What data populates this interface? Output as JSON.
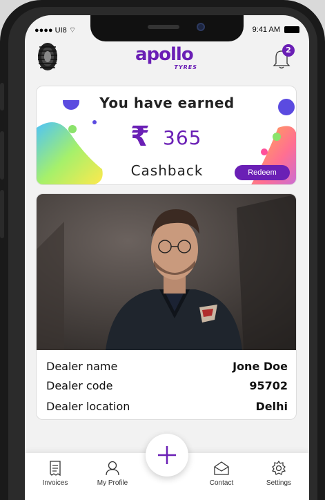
{
  "status_bar": {
    "carrier": "UI8",
    "time": "9:41 AM"
  },
  "header": {
    "logo_text": "apollo",
    "logo_subtext": "TYRES",
    "notification_count": "2"
  },
  "cashback": {
    "title": "You have earned",
    "currency_symbol": "₹",
    "amount": "365",
    "label": "Cashback",
    "redeem_label": "Redeem"
  },
  "dealer": {
    "rows": [
      {
        "label": "Dealer name",
        "value": "Jone Doe"
      },
      {
        "label": "Dealer code",
        "value": "95702"
      },
      {
        "label": "Dealer location",
        "value": "Delhi"
      }
    ]
  },
  "nav": {
    "items": [
      {
        "label": "Invoices",
        "icon": "receipt-icon"
      },
      {
        "label": "My Profile",
        "icon": "user-icon"
      },
      {
        "label": "Contact",
        "icon": "mail-open-icon"
      },
      {
        "label": "Settings",
        "icon": "gear-icon"
      }
    ],
    "fab_icon": "plus-icon"
  },
  "colors": {
    "brand": "#6a1fb5",
    "background": "#f2f2f2"
  }
}
